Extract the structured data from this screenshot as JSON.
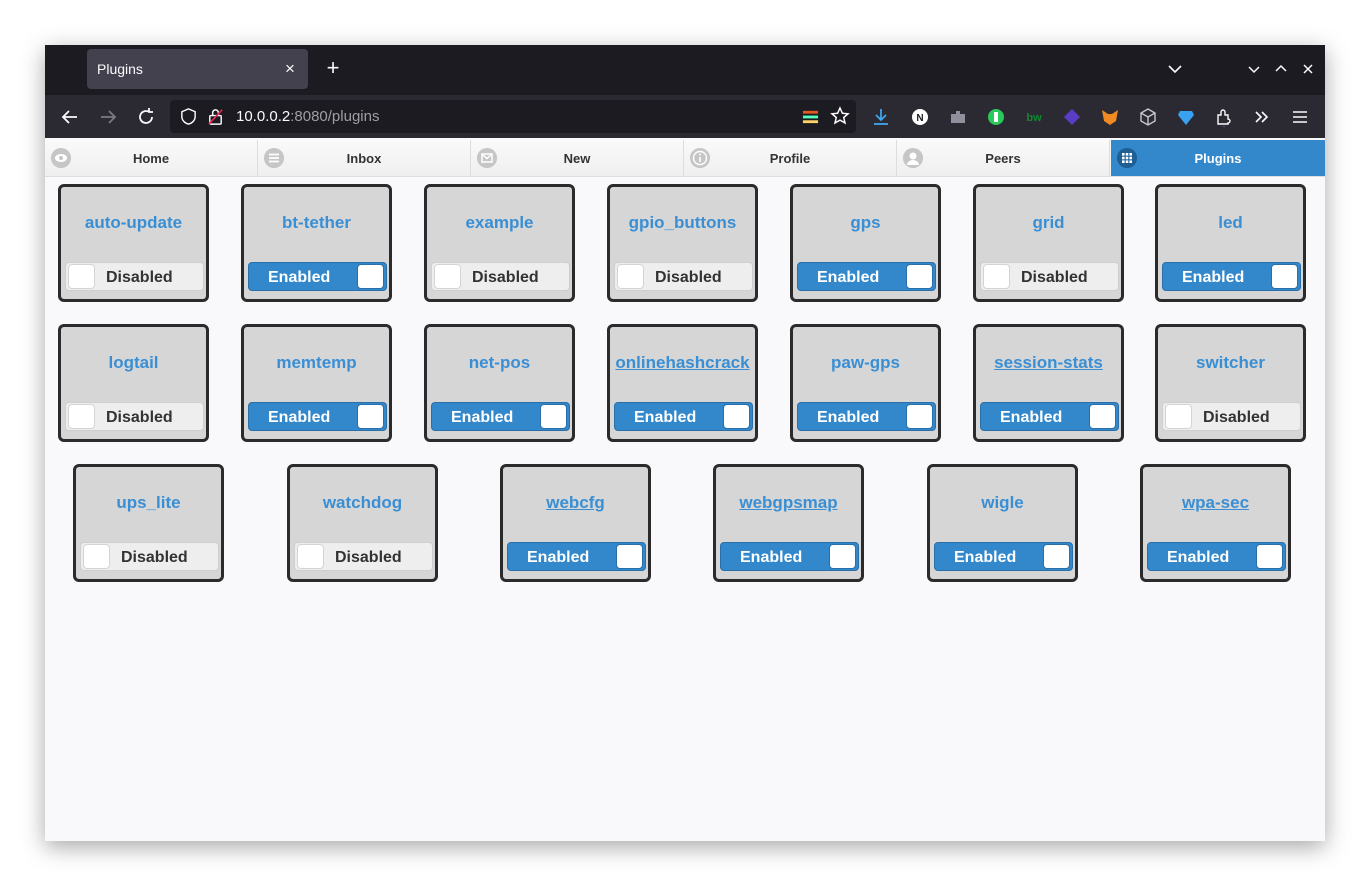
{
  "browser": {
    "tab_title": "Plugins",
    "tab_close": "×",
    "new_tab": "+",
    "url_host": "10.0.0.2",
    "url_rest": ":8080/plugins",
    "icons": [
      "back-icon",
      "forward-icon",
      "reload-icon",
      "shield-icon",
      "lock-icon",
      "bookmark-star-icon",
      "downloads-icon",
      "extensions-icon",
      "overflow-icon",
      "menu-icon"
    ]
  },
  "nav": {
    "items": [
      {
        "label": "Home",
        "icon": "eye-icon"
      },
      {
        "label": "Inbox",
        "icon": "list-icon"
      },
      {
        "label": "New",
        "icon": "mail-icon"
      },
      {
        "label": "Profile",
        "icon": "info-icon"
      },
      {
        "label": "Peers",
        "icon": "user-icon"
      },
      {
        "label": "Plugins",
        "icon": "grid-icon",
        "active": true
      }
    ]
  },
  "plugins": [
    {
      "name": "auto-update",
      "state": "Disabled",
      "link": false
    },
    {
      "name": "bt-tether",
      "state": "Enabled",
      "link": false
    },
    {
      "name": "example",
      "state": "Disabled",
      "link": false
    },
    {
      "name": "gpio_buttons",
      "state": "Disabled",
      "link": false
    },
    {
      "name": "gps",
      "state": "Enabled",
      "link": false
    },
    {
      "name": "grid",
      "state": "Disabled",
      "link": false
    },
    {
      "name": "led",
      "state": "Enabled",
      "link": false
    },
    {
      "name": "logtail",
      "state": "Disabled",
      "link": false
    },
    {
      "name": "memtemp",
      "state": "Enabled",
      "link": false
    },
    {
      "name": "net-pos",
      "state": "Enabled",
      "link": false
    },
    {
      "name": "onlinehashcrack",
      "state": "Enabled",
      "link": true
    },
    {
      "name": "paw-gps",
      "state": "Enabled",
      "link": false
    },
    {
      "name": "session-stats",
      "state": "Enabled",
      "link": true
    },
    {
      "name": "switcher",
      "state": "Disabled",
      "link": false
    },
    {
      "name": "ups_lite",
      "state": "Disabled",
      "link": false
    },
    {
      "name": "watchdog",
      "state": "Disabled",
      "link": false
    },
    {
      "name": "webcfg",
      "state": "Enabled",
      "link": true
    },
    {
      "name": "webgpsmap",
      "state": "Enabled",
      "link": true
    },
    {
      "name": "wigle",
      "state": "Enabled",
      "link": false
    },
    {
      "name": "wpa-sec",
      "state": "Enabled",
      "link": true
    }
  ],
  "colors": {
    "accent": "#3388cc",
    "link": "#3a8fd4",
    "card": "#d6d6d6"
  }
}
